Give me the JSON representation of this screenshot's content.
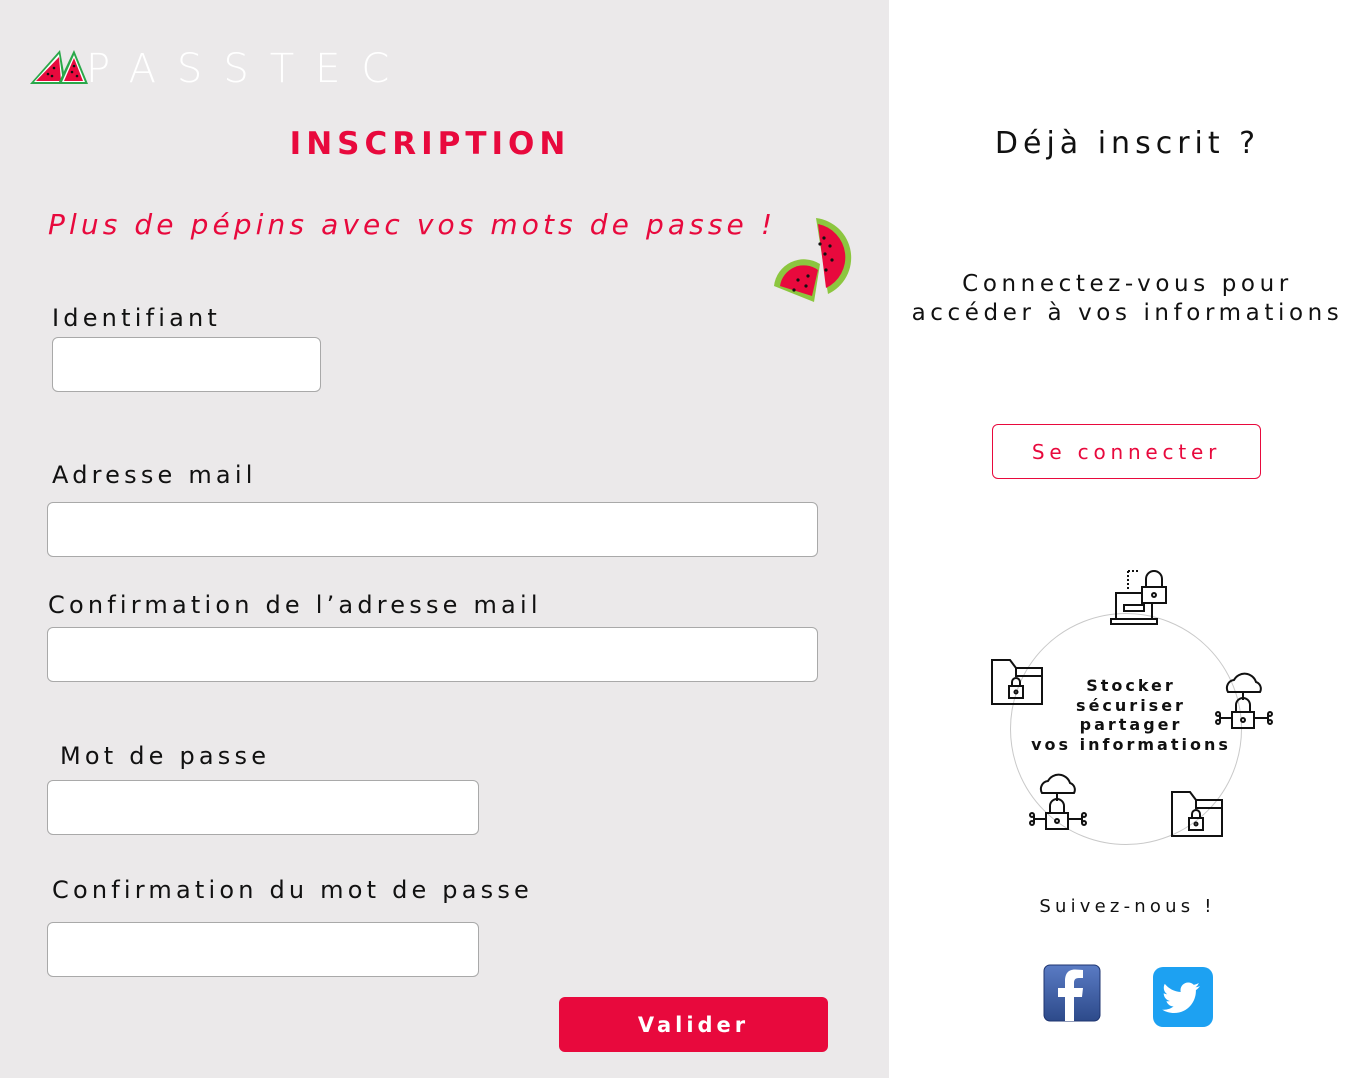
{
  "brand": {
    "name": "PASSTEC",
    "logo_icon": "watermelon-icon"
  },
  "colors": {
    "accent": "#e8093d",
    "left_bg": "#ebe9ea",
    "right_bg": "#ffffff"
  },
  "signup": {
    "title": "INSCRIPTION",
    "tagline": "Plus de pépins avec vos mots de passe !",
    "fields": {
      "username": {
        "label": "Identifiant",
        "value": "",
        "placeholder": ""
      },
      "email": {
        "label": "Adresse mail",
        "value": "",
        "placeholder": ""
      },
      "email_confirm": {
        "label": "Confirmation de l’adresse mail",
        "value": "",
        "placeholder": ""
      },
      "password": {
        "label": "Mot de passe",
        "value": "",
        "placeholder": ""
      },
      "password_confirm": {
        "label": "Confirmation du mot de passe",
        "value": "",
        "placeholder": ""
      }
    },
    "submit_label": "Valider"
  },
  "login": {
    "title": "Déjà inscrit ?",
    "subtitle_line1": "Connectez-vous pour",
    "subtitle_line2": "accéder à vos informations",
    "button_label": "Se connecter"
  },
  "features": {
    "lines": [
      "Stocker",
      "sécuriser",
      "partager",
      "vos informations"
    ],
    "icons": [
      "laptop-lock-icon",
      "cloud-lock-icon",
      "folder-lock-icon",
      "cloud-lock-icon",
      "folder-lock-icon"
    ]
  },
  "social": {
    "title": "Suivez-nous !",
    "links": [
      {
        "icon": "facebook-icon"
      },
      {
        "icon": "twitter-icon"
      }
    ]
  }
}
